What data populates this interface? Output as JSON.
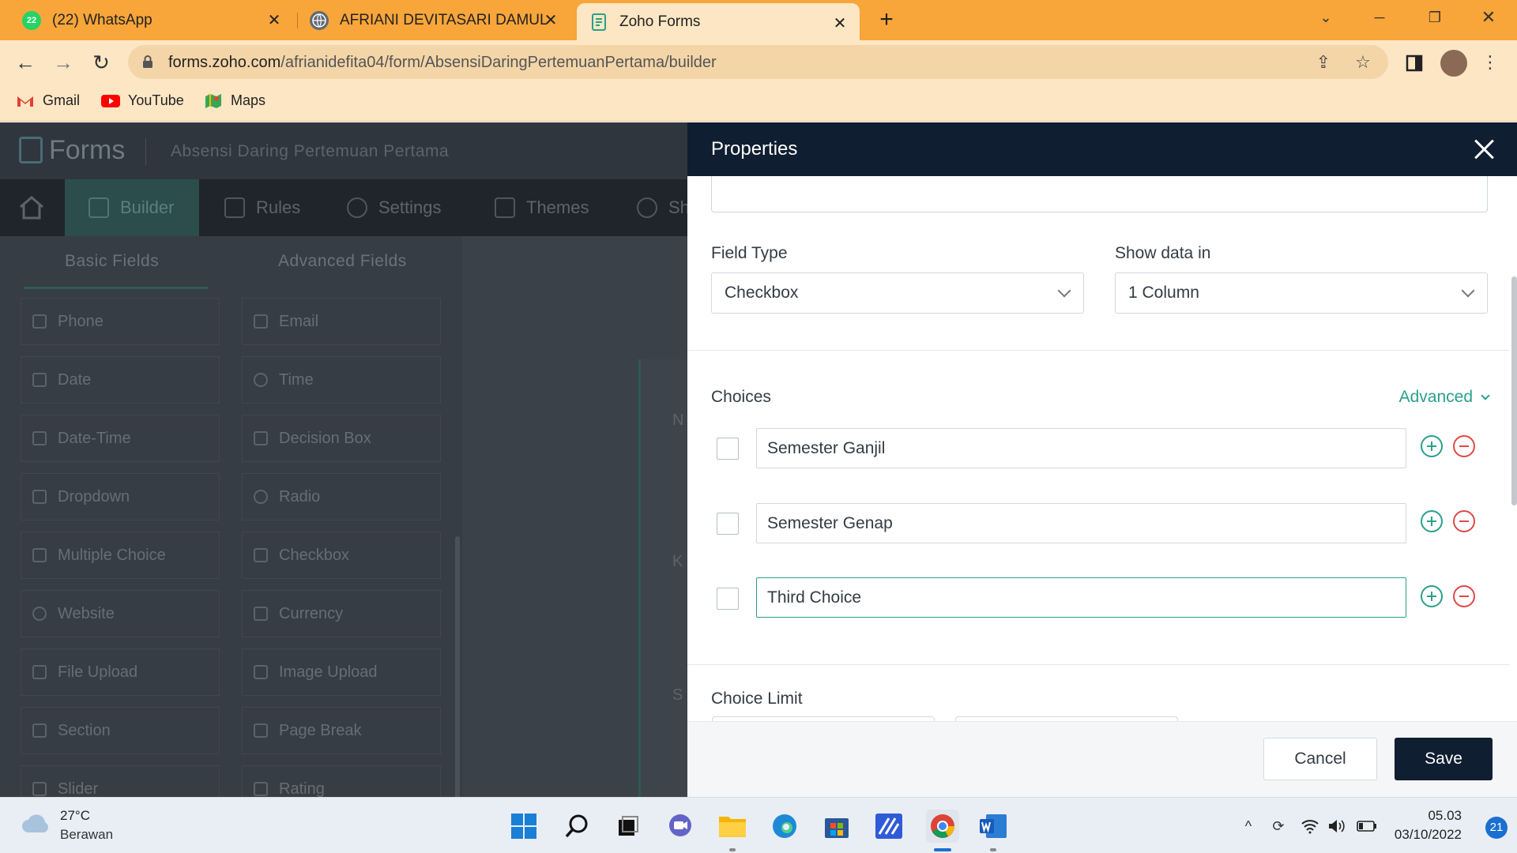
{
  "browser": {
    "tabs": [
      {
        "title": "(22) WhatsApp",
        "badge": "22"
      },
      {
        "title": "AFRIANI DEVITASARI DAMULAW"
      },
      {
        "title": "Zoho Forms"
      }
    ],
    "url_host": "forms.zoho.com",
    "url_path": "/afrianidefita04/form/AbsensiDaringPertemuanPertama/builder",
    "bookmarks": [
      "Gmail",
      "YouTube",
      "Maps"
    ],
    "colors": {
      "chrome": "#f8a53a",
      "toolbar": "#fde6c4"
    }
  },
  "app": {
    "brand": "Forms",
    "form_name": "Absensi Daring Pertemuan Pertama",
    "nav": [
      {
        "label": "Builder",
        "active": true
      },
      {
        "label": "Rules"
      },
      {
        "label": "Settings"
      },
      {
        "label": "Themes"
      },
      {
        "label": "Sh"
      }
    ],
    "field_tabs": [
      "Basic Fields",
      "Advanced Fields"
    ],
    "fields_left": [
      "Phone",
      "Date",
      "Date-Time",
      "Dropdown",
      "Multiple Choice",
      "Website",
      "File Upload",
      "Section",
      "Slider"
    ],
    "fields_right": [
      "Email",
      "Time",
      "Decision Box",
      "Radio",
      "Checkbox",
      "Currency",
      "Image Upload",
      "Page Break",
      "Rating"
    ],
    "canvas_peek": [
      "N",
      "K",
      "S",
      "*"
    ]
  },
  "properties": {
    "title": "Properties",
    "field_type_label": "Field Type",
    "field_type_value": "Checkbox",
    "show_data_label": "Show data in",
    "show_data_value": "1 Column",
    "choices_label": "Choices",
    "advanced_label": "Advanced",
    "choices": [
      "Semester Ganjil",
      "Semester Genap",
      "Third Choice"
    ],
    "choice_limit_label": "Choice Limit",
    "cancel_label": "Cancel",
    "save_label": "Save",
    "accent_color": "#2aa08b",
    "remove_color": "#e04848",
    "header_color": "#0f1e30"
  },
  "taskbar": {
    "temperature": "27°C",
    "weather": "Berawan",
    "time": "05.03",
    "date": "03/10/2022",
    "notifications": "21"
  }
}
